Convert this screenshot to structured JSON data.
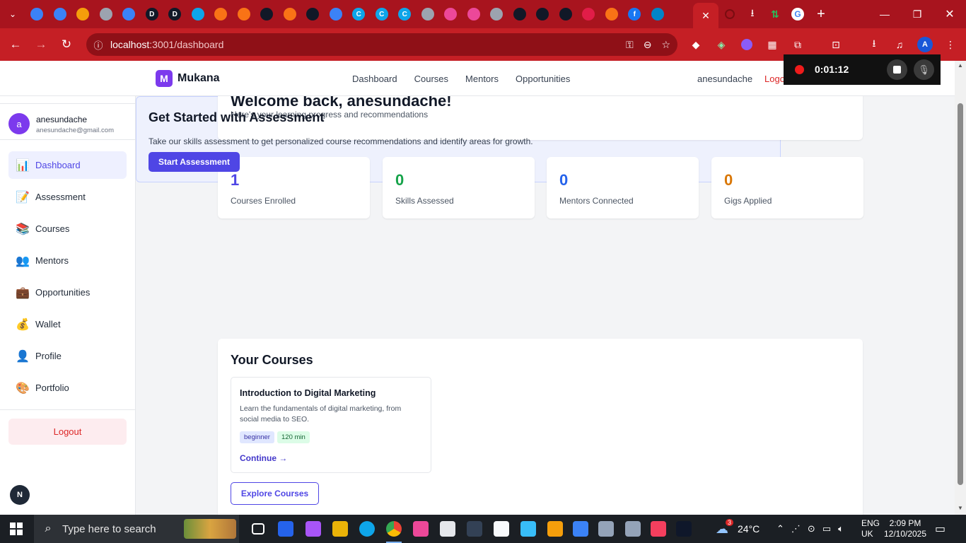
{
  "browser": {
    "url_host": "localhost",
    "url_path": ":3001/dashboard",
    "tab_colors": [
      "#3b82f6",
      "#3b82f6",
      "#f59e0b",
      "#9ca3af",
      "#3b82f6",
      "#111827",
      "#111827",
      "#0ea5e9",
      "#f97316",
      "#f97316",
      "#111827",
      "#f97316",
      "#111827",
      "#3b82f6",
      "#0ea5e9",
      "#0ea5e9",
      "#0ea5e9",
      "#9ca3af",
      "#ec4899",
      "#ec4899",
      "#9ca3af",
      "#111827",
      "#111827",
      "#111827",
      "#e11d48",
      "#f97316",
      "#1877f2",
      "#0284c7"
    ],
    "tab_letters": [
      "",
      "",
      "",
      "",
      "",
      "D",
      "D",
      "",
      "",
      "",
      "",
      "",
      "",
      "",
      "C",
      "C",
      "C",
      "",
      "",
      "",
      "",
      "",
      "",
      "",
      "",
      "",
      "f",
      ""
    ]
  },
  "recorder": {
    "time": "0:01:12"
  },
  "header": {
    "brand_letter": "M",
    "brand_name": "Mukana",
    "nav": [
      "Dashboard",
      "Courses",
      "Mentors",
      "Opportunities"
    ],
    "username": "anesundache",
    "logout": "Logo"
  },
  "sidebar": {
    "avatar_letter": "a",
    "user_name": "anesundache",
    "user_email": "anesundache@gmail.com",
    "items": [
      {
        "label": "Dashboard",
        "icon": "chart-icon",
        "glyph": "📊",
        "active": true
      },
      {
        "label": "Assessment",
        "icon": "memo-icon",
        "glyph": "📝",
        "active": false
      },
      {
        "label": "Courses",
        "icon": "books-icon",
        "glyph": "📚",
        "active": false
      },
      {
        "label": "Mentors",
        "icon": "people-icon",
        "glyph": "👥",
        "active": false
      },
      {
        "label": "Opportunities",
        "icon": "briefcase-icon",
        "glyph": "💼",
        "active": false
      },
      {
        "label": "Wallet",
        "icon": "money-bag-icon",
        "glyph": "💰",
        "active": false
      },
      {
        "label": "Profile",
        "icon": "person-icon",
        "glyph": "👤",
        "active": false
      },
      {
        "label": "Portfolio",
        "icon": "palette-icon",
        "glyph": "🎨",
        "active": false
      }
    ],
    "logout": "Logout",
    "badge_letter": "N"
  },
  "welcome": {
    "title": "Welcome back, anesundache!",
    "subtitle": "Here's your learning progress and recommendations"
  },
  "stats": [
    {
      "value": "1",
      "label": "Courses Enrolled",
      "color": "#4f46e5"
    },
    {
      "value": "0",
      "label": "Skills Assessed",
      "color": "#16a34a"
    },
    {
      "value": "0",
      "label": "Mentors Connected",
      "color": "#2563eb"
    },
    {
      "value": "0",
      "label": "Gigs Applied",
      "color": "#d97706"
    }
  ],
  "assessment": {
    "title": "Get Started with Assessment",
    "description": "Take our skills assessment to get personalized course recommendations and identify areas for growth.",
    "button": "Start Assessment"
  },
  "courses": {
    "title": "Your Courses",
    "items": [
      {
        "title": "Introduction to Digital Marketing",
        "description": "Learn the fundamentals of digital marketing, from social media to SEO.",
        "level": "beginner",
        "duration": "120 min",
        "action": "Continue →"
      }
    ],
    "explore_button": "Explore Courses"
  },
  "taskbar": {
    "search_placeholder": "Type here to search",
    "weather_temp": "24°C",
    "weather_badge": "3",
    "lang_line1": "ENG",
    "lang_line2": "UK",
    "time": "2:09 PM",
    "date": "12/10/2025"
  }
}
